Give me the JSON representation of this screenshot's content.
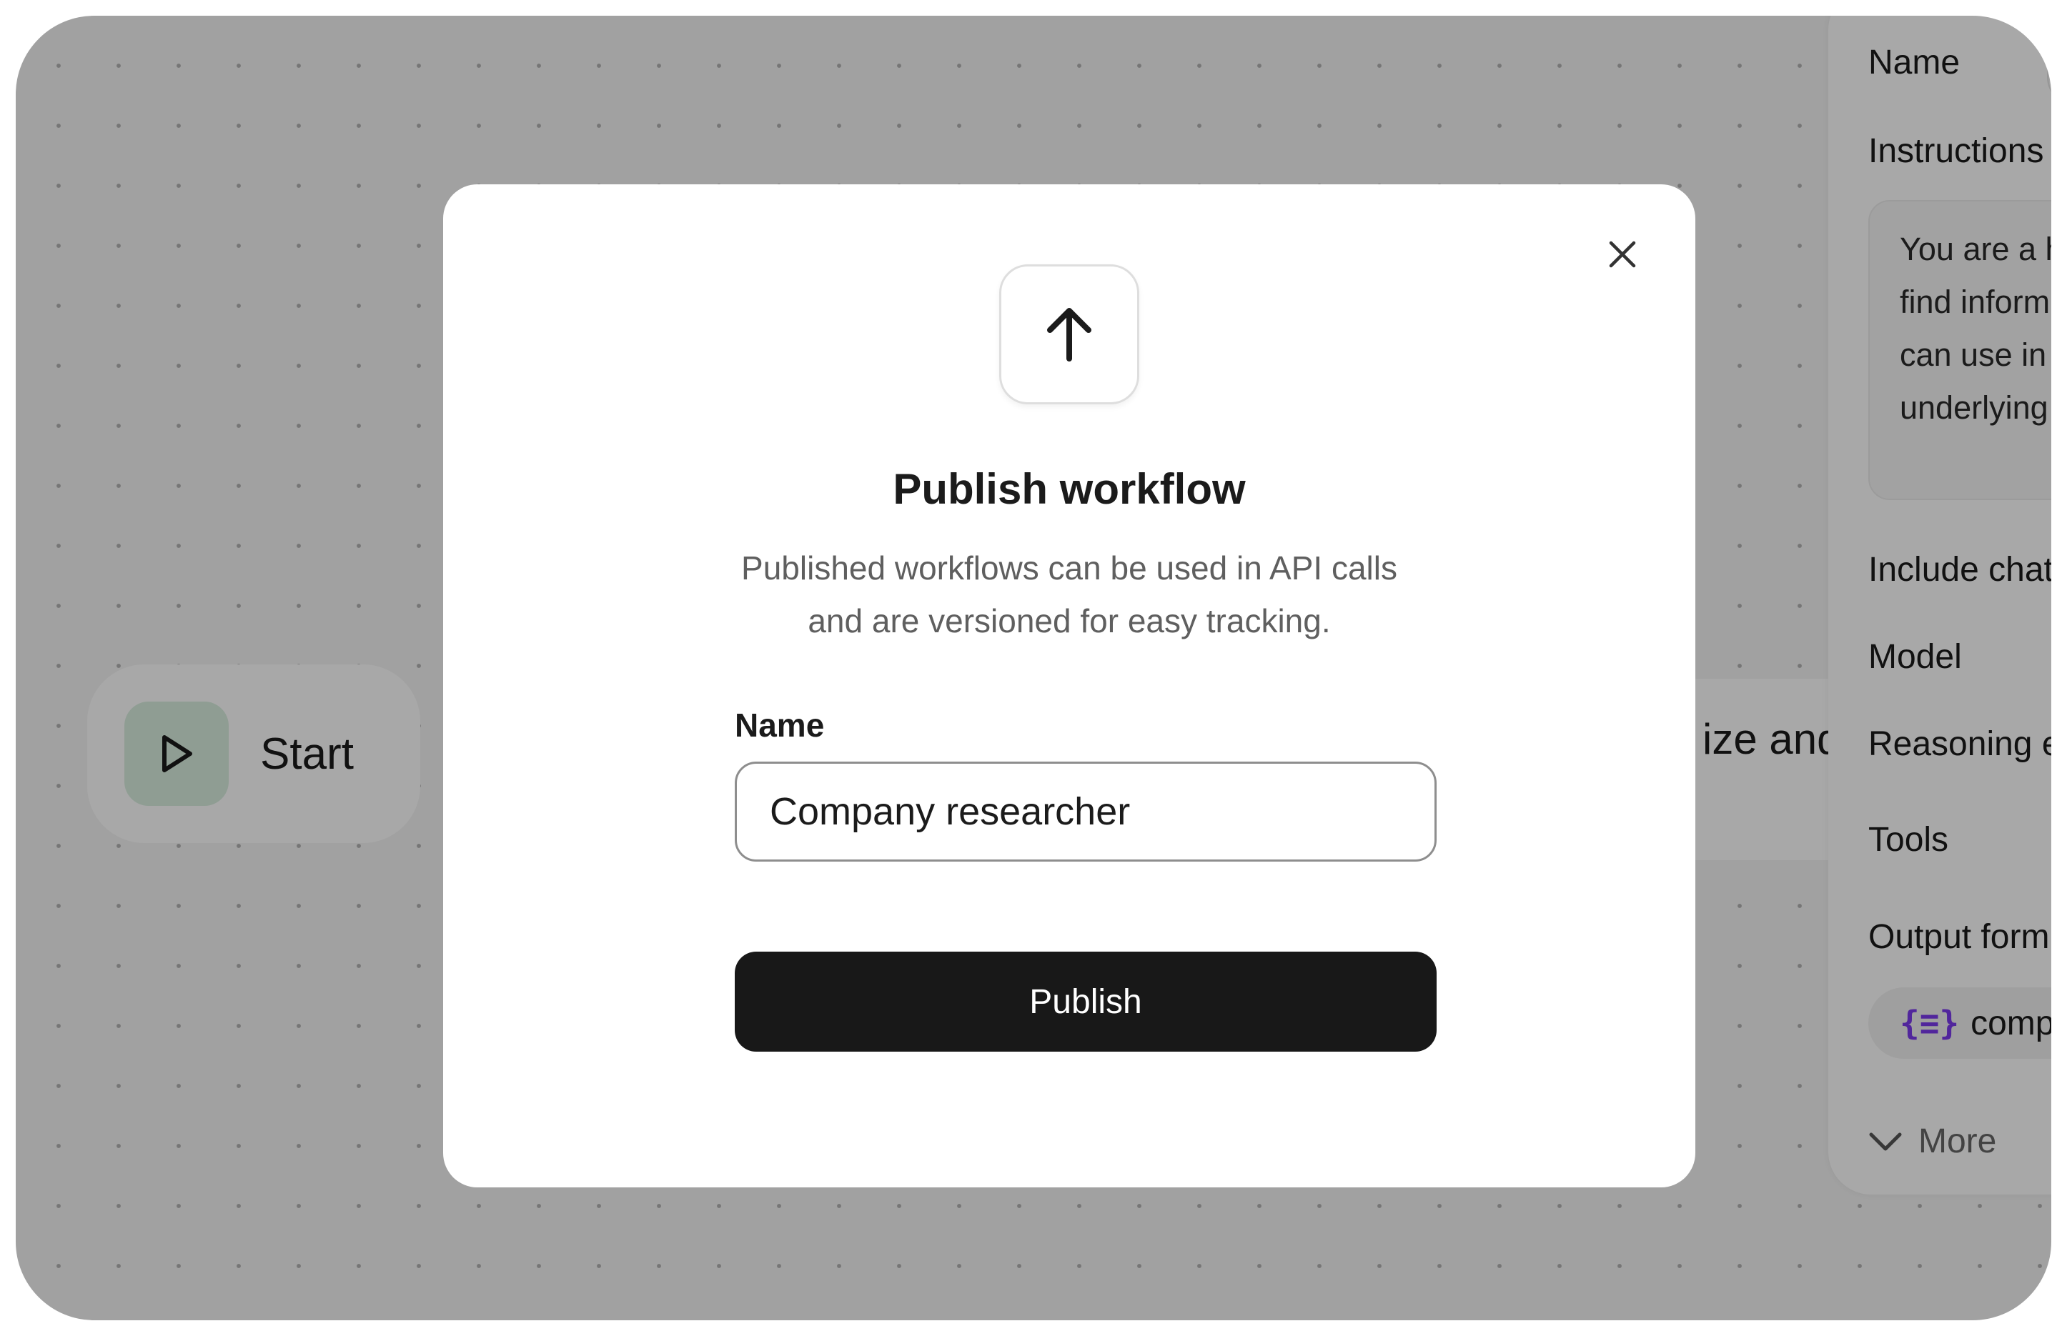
{
  "canvas": {
    "start_node_label": "Start",
    "agent_node_partial_label": "ize and"
  },
  "side_panel": {
    "name_label": "Name",
    "instructions_label": "Instructions",
    "instructions_lines": [
      "You are a h",
      "find inform",
      "can use in",
      "underlying"
    ],
    "include_chat_label": "Include chat",
    "model_label": "Model",
    "reasoning_label": "Reasoning e",
    "tools_label": "Tools",
    "output_format_label": "Output form",
    "schema_pill_text": "compa",
    "more_label": "More"
  },
  "modal": {
    "icon": "arrow-up-icon",
    "title": "Publish workflow",
    "description_line1": "Published workflows can be used in API calls",
    "description_line2": "and are versioned for easy tracking.",
    "name_label": "Name",
    "name_value": "Company researcher",
    "publish_label": "Publish",
    "close_icon": "close-icon"
  },
  "colors": {
    "overlay": "#00000057",
    "publish_button": "#181818",
    "start_icon_bg": "#d9efe0",
    "schema_icon": "#7c3aed"
  }
}
